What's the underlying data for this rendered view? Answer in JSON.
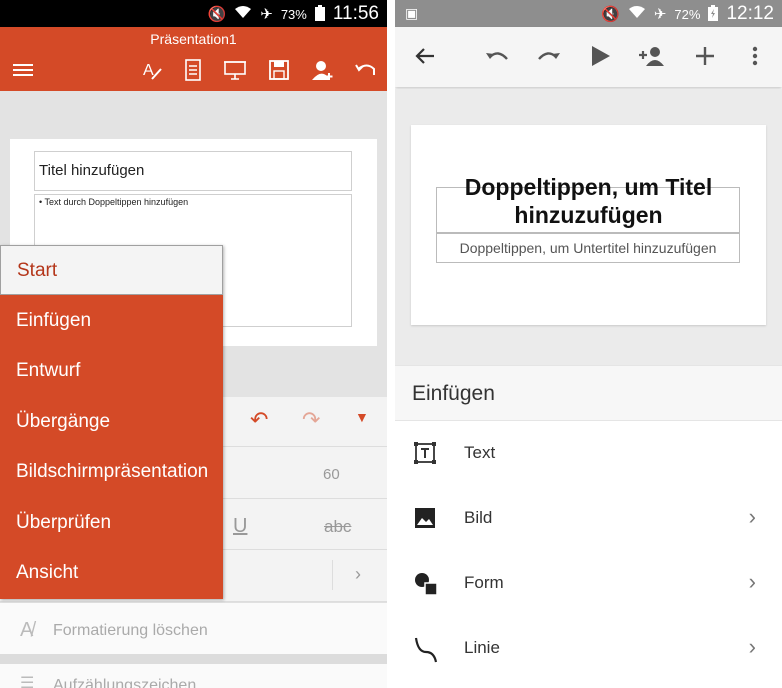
{
  "left": {
    "status": {
      "battery": "73%",
      "time": "11:56"
    },
    "doc_title": "Präsentation1",
    "slide": {
      "title_placeholder": "Titel hinzufügen",
      "body_placeholder": "• Text durch Doppeltippen hinzufügen"
    },
    "menu": [
      {
        "label": "Start",
        "selected": true
      },
      {
        "label": "Einfügen"
      },
      {
        "label": "Entwurf"
      },
      {
        "label": "Übergänge"
      },
      {
        "label": "Bildschirmpräsentation"
      },
      {
        "label": "Überprüfen"
      },
      {
        "label": "Ansicht"
      }
    ],
    "ribbon": {
      "font_size": "60",
      "underline": "U",
      "strike": "abc"
    },
    "format_rows": {
      "clear_format": "Formatierung löschen",
      "bullets": "Aufzählungszeichen"
    }
  },
  "right": {
    "status": {
      "battery": "72%",
      "time": "12:12"
    },
    "slide": {
      "title_placeholder": "Doppeltippen, um Titel hinzuzufügen",
      "subtitle_placeholder": "Doppeltippen, um Untertitel hinzuzufügen"
    },
    "insert_header": "Einfügen",
    "insert_items": [
      {
        "label": "Text",
        "icon": "text-box-icon"
      },
      {
        "label": "Bild",
        "icon": "image-icon"
      },
      {
        "label": "Form",
        "icon": "shapes-icon"
      },
      {
        "label": "Linie",
        "icon": "line-icon"
      }
    ]
  },
  "colors": {
    "accent": "#d44a27",
    "menu_selected_text": "#b4361a"
  }
}
